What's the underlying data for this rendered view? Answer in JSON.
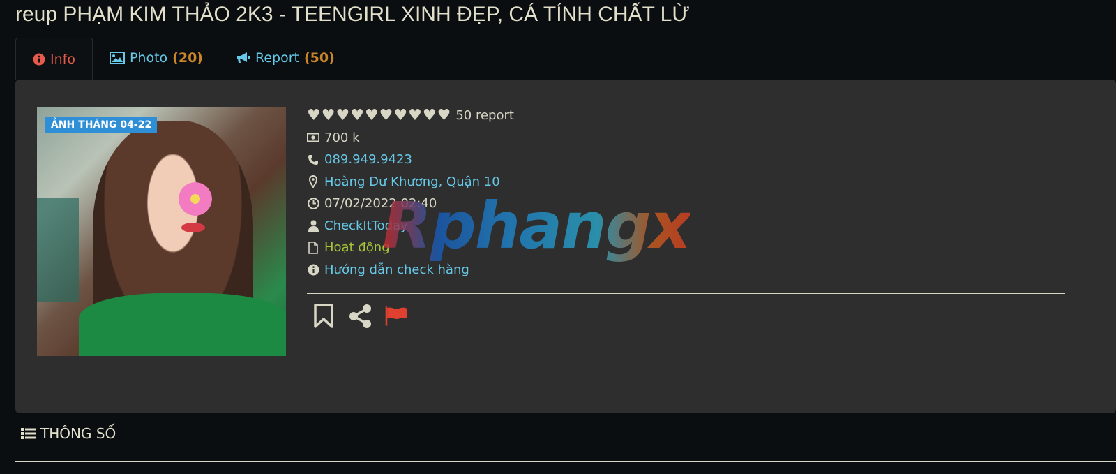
{
  "page": {
    "title": "reup PHẠM KIM THẢO 2K3 - TEENGIRL XINH ĐẸP, CÁ TÍNH CHẤT LỪ"
  },
  "tabs": [
    {
      "label": "Info",
      "count": "",
      "icon": "info-circle-icon",
      "active": true
    },
    {
      "label": "Photo",
      "count": "(20)",
      "icon": "image-icon",
      "active": false
    },
    {
      "label": "Report",
      "count": "(50)",
      "icon": "bullhorn-icon",
      "active": false
    }
  ],
  "photo": {
    "badge": "ẢNH THÁNG 04-22"
  },
  "info": {
    "rating_hearts": 10,
    "report_text": "50 report",
    "price": "700 k",
    "phone": "089.949.9423",
    "location": "Hoàng Dư Khương, Quận 10",
    "datetime": "07/02/2022 02:40",
    "user": "CheckItToday",
    "status": "Hoạt động",
    "guide": "Hướng dẫn check hàng"
  },
  "watermark": "Rphangx",
  "section": {
    "title": "THÔNG SỐ"
  },
  "colors": {
    "background": "#0b0e10",
    "panel": "#2e2e2e",
    "link": "#67c9e8",
    "count": "#c98528",
    "active_tab": "#e65a4a",
    "status": "#a6c33a",
    "badge": "#2f8fd6",
    "flag": "#e04030"
  }
}
